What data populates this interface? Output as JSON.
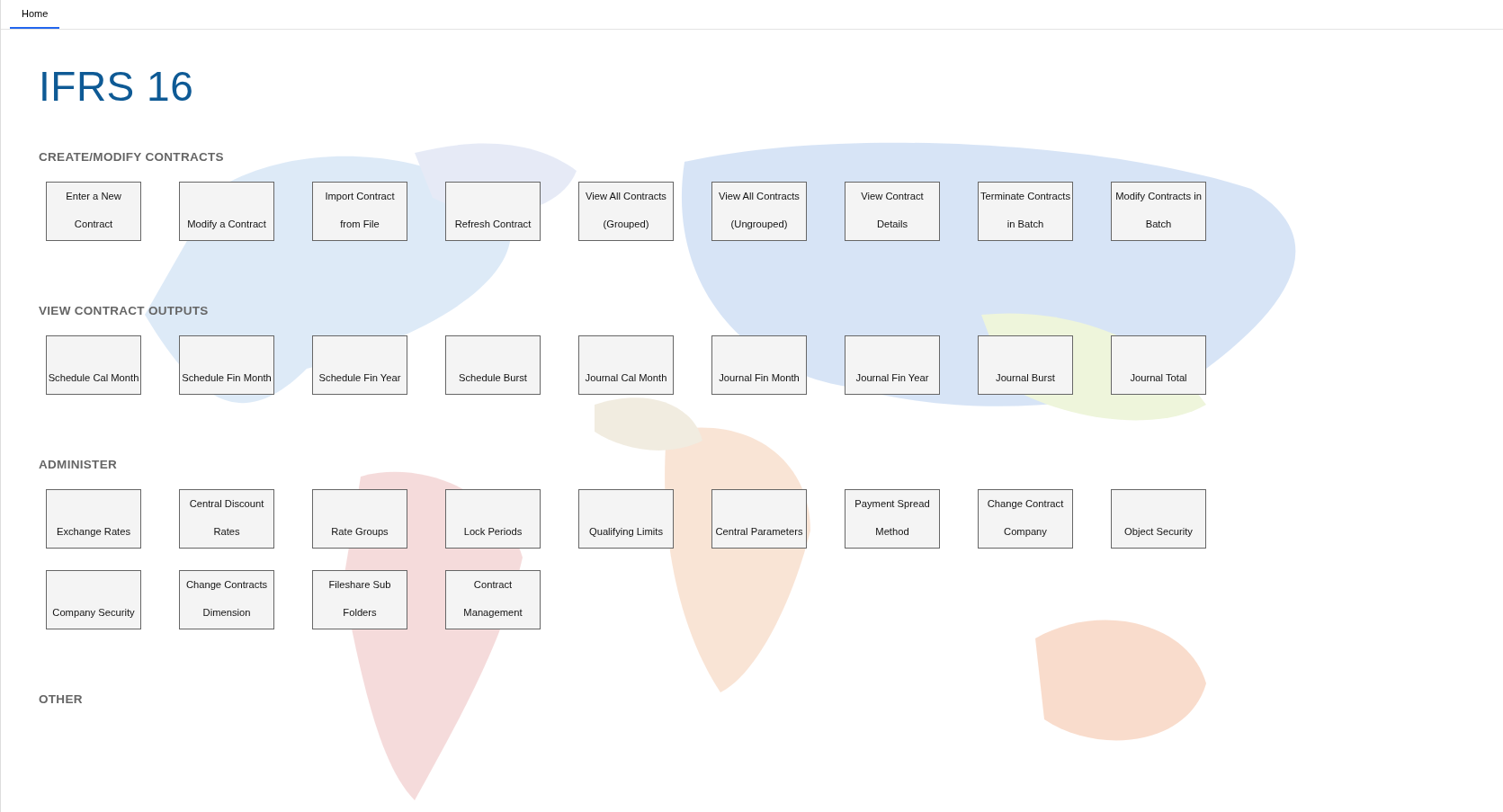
{
  "tabs": [
    {
      "label": "Home",
      "selected": true
    }
  ],
  "title": "IFRS 16",
  "sections": [
    {
      "heading": "CREATE/MODIFY CONTRACTS",
      "buttons": [
        "Enter a New Contract",
        "Modify a Contract",
        "Import Contract from File",
        "Refresh Contract",
        "View All Contracts (Grouped)",
        "View All Contracts (Ungrouped)",
        "View Contract Details",
        "Terminate Contracts in Batch",
        "Modify Contracts in Batch"
      ]
    },
    {
      "heading": "VIEW CONTRACT OUTPUTS",
      "buttons": [
        "Schedule Cal Month",
        "Schedule Fin Month",
        "Schedule Fin Year",
        "Schedule Burst",
        "Journal Cal Month",
        "Journal Fin Month",
        "Journal Fin Year",
        "Journal Burst",
        "Journal Total"
      ]
    },
    {
      "heading": "ADMINISTER",
      "buttons": [
        "Exchange Rates",
        "Central Discount Rates",
        "Rate Groups",
        "Lock Periods",
        "Qualifying Limits",
        "Central Parameters",
        "Payment Spread Method",
        "Change Contract Company",
        "Object Security",
        "Company Security",
        "Change Contracts Dimension",
        "Fileshare Sub Folders",
        "Contract Management"
      ]
    },
    {
      "heading": "OTHER"
    }
  ]
}
